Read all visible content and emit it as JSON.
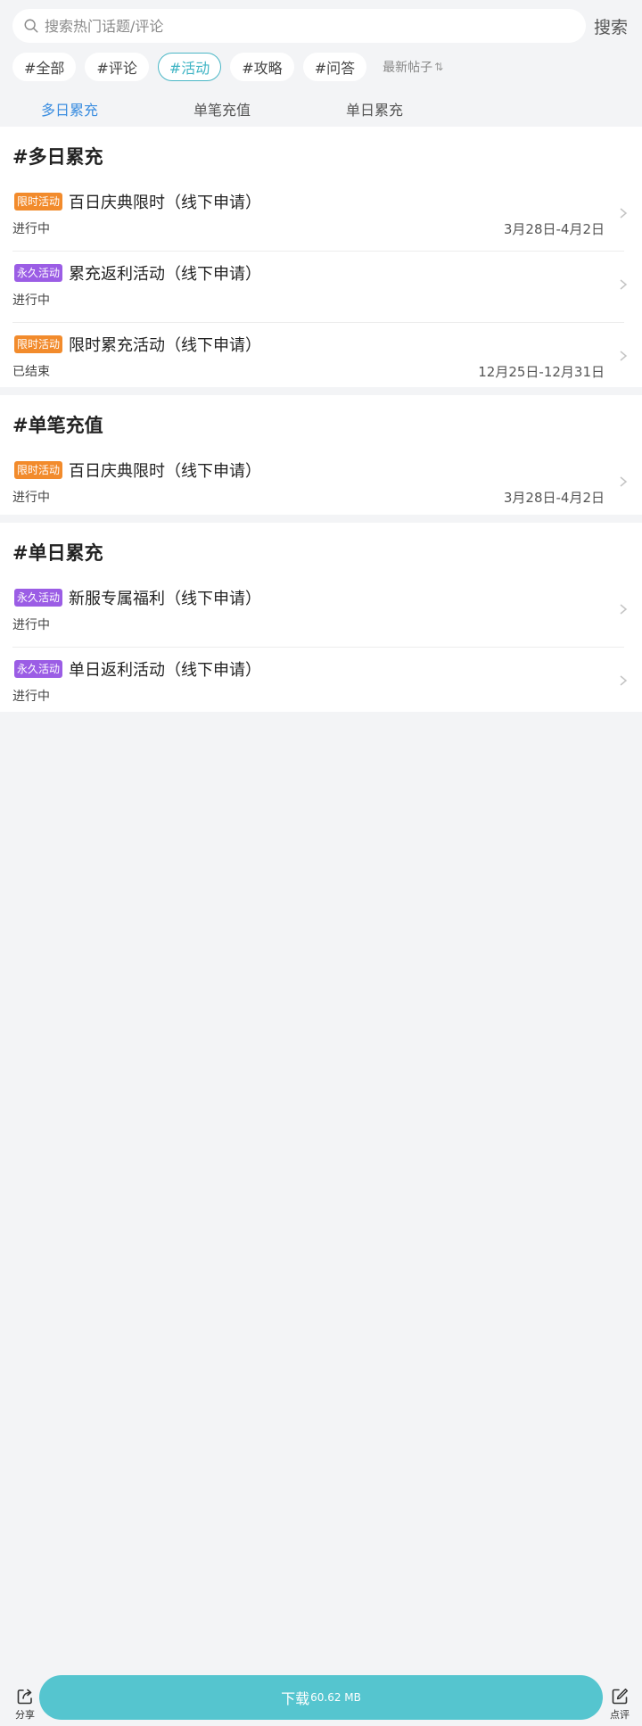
{
  "search": {
    "placeholder": "搜索热门话题/评论",
    "button_label": "搜索"
  },
  "tags": [
    "#全部",
    "#评论",
    "#活动",
    "#攻略",
    "#问答"
  ],
  "active_tag": "#活动",
  "sort": {
    "label": "最新帖子",
    "icon": "sort-arrows-icon"
  },
  "subtabs": [
    "多日累充",
    "单笔充值",
    "单日累充"
  ],
  "active_subtab": "多日累充",
  "sections": [
    {
      "title": "#多日累充",
      "items": [
        {
          "badge": "限时活动",
          "badge_type": "limited",
          "title": "百日庆典限时（线下申请）",
          "status": "进行中",
          "date": "3月28日-4月2日"
        },
        {
          "badge": "永久活动",
          "badge_type": "permanent",
          "title": "累充返利活动（线下申请）",
          "status": "进行中",
          "date": ""
        },
        {
          "badge": "限时活动",
          "badge_type": "limited",
          "title": "限时累充活动（线下申请）",
          "status": "已结束",
          "date": "12月25日-12月31日"
        }
      ]
    },
    {
      "title": "#单笔充值",
      "items": [
        {
          "badge": "限时活动",
          "badge_type": "limited",
          "title": "百日庆典限时（线下申请）",
          "status": "进行中",
          "date": "3月28日-4月2日"
        }
      ]
    },
    {
      "title": "#单日累充",
      "items": [
        {
          "badge": "永久活动",
          "badge_type": "permanent",
          "title": "新服专属福利（线下申请）",
          "status": "进行中",
          "date": ""
        },
        {
          "badge": "永久活动",
          "badge_type": "permanent",
          "title": "单日返利活动（线下申请）",
          "status": "进行中",
          "date": ""
        }
      ]
    }
  ],
  "bottom_bar": {
    "share_label": "分享",
    "review_label": "点评",
    "download_label": "下载",
    "download_size": "60.62 MB"
  },
  "colors": {
    "accent": "#55c5cf",
    "active_tab": "#3a8de0",
    "limited_badge": "#f28b2c",
    "permanent_badge": "#9b5de5",
    "background": "#f3f4f6"
  }
}
